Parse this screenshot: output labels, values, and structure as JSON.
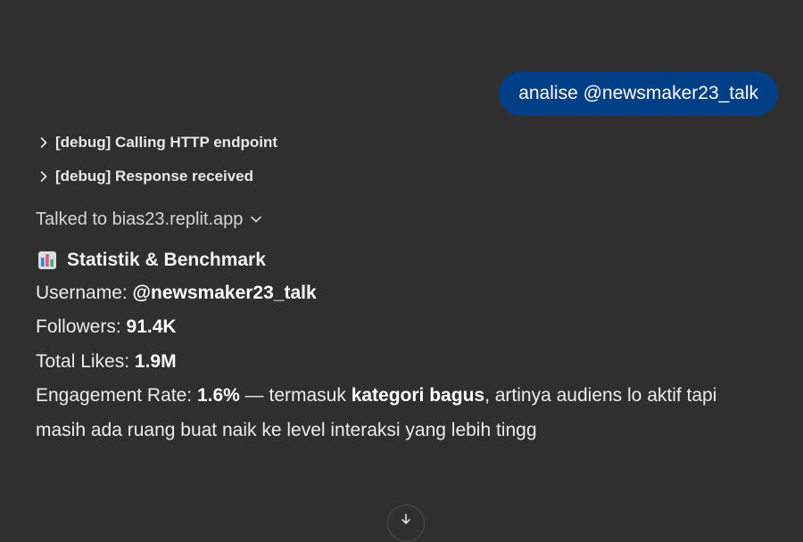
{
  "user_message": "analise @newsmaker23_talk",
  "debug_steps": [
    {
      "label": "[debug] Calling HTTP endpoint"
    },
    {
      "label": "[debug] Response received"
    }
  ],
  "talked_to": "Talked to bias23.replit.app",
  "response": {
    "heading_icon": "bar-chart-emoji-icon",
    "heading": "Statistik & Benchmark",
    "username_label": "Username: ",
    "username_value": "@newsmaker23_talk",
    "followers_label": "Followers: ",
    "followers_value": "91.4K",
    "likes_label": "Total Likes: ",
    "likes_value": "1.9M",
    "engagement_label": "Engagement Rate: ",
    "engagement_value": "1.6%",
    "engagement_mid": " — termasuk ",
    "engagement_category": "kategori bagus",
    "engagement_tail": ", artinya audiens lo aktif tapi",
    "engagement_line2": "masih ada ruang buat naik ke level interaksi yang lebih tingg"
  },
  "colors": {
    "background": "#2f2f2f",
    "user_bubble": "#003f86"
  }
}
